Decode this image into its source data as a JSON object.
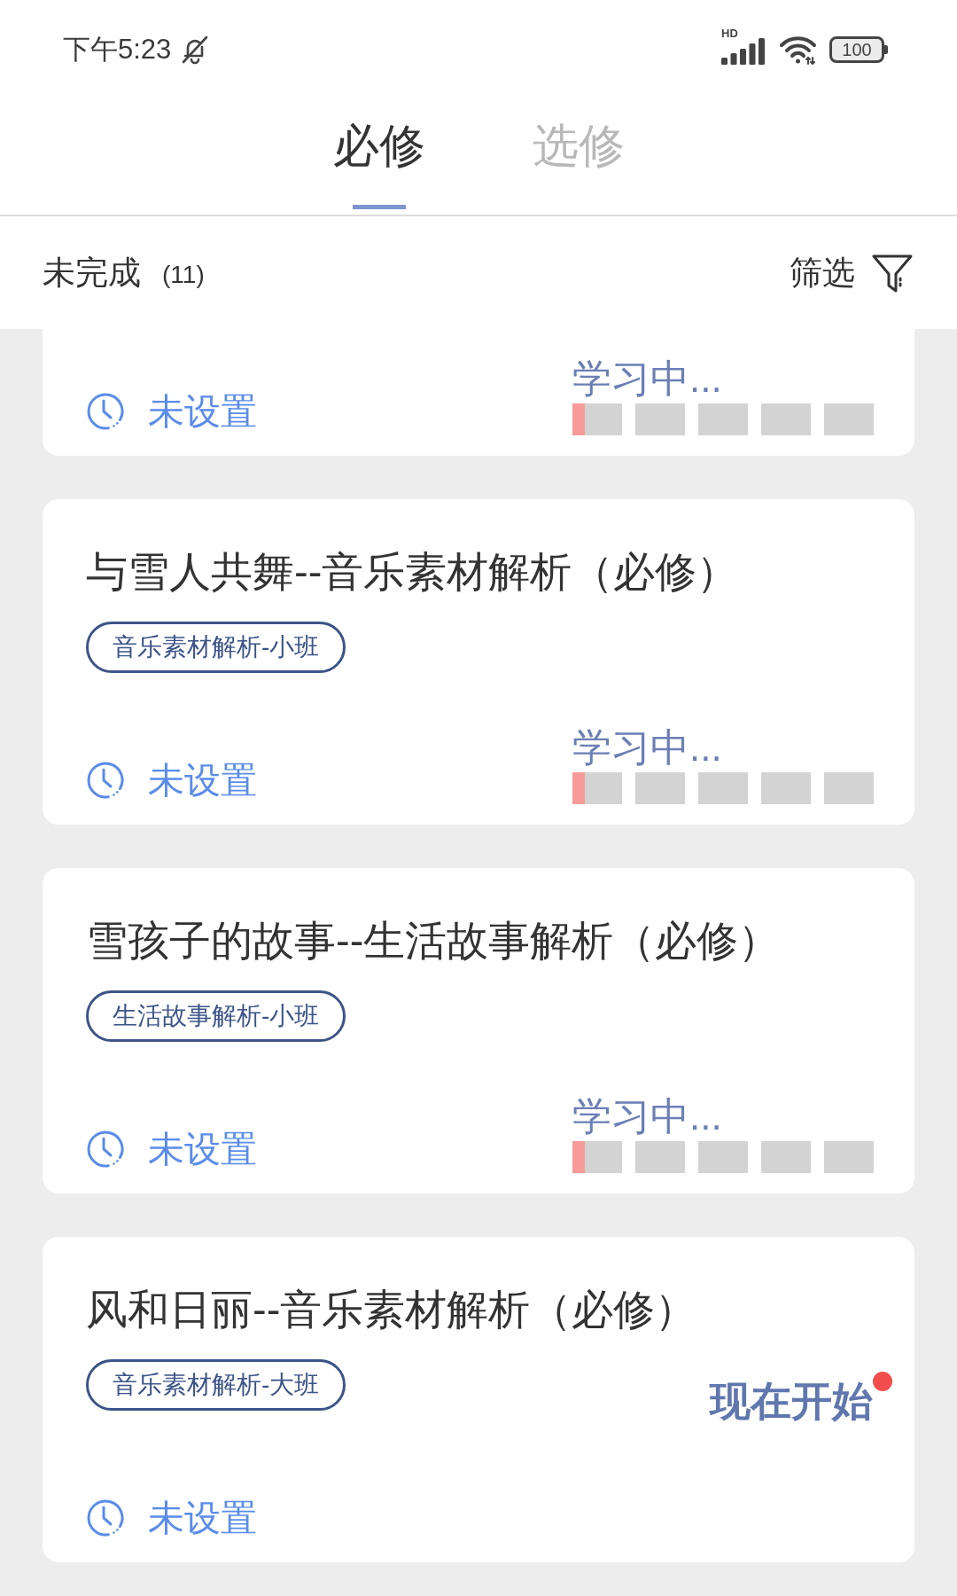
{
  "status_bar": {
    "time": "下午5:23",
    "network_label": "HD",
    "battery": "100"
  },
  "tabs": [
    {
      "label": "必修",
      "selected": true
    },
    {
      "label": "选修",
      "selected": false
    }
  ],
  "filter_bar": {
    "label": "未完成",
    "count": "(11)",
    "filter_label": "筛选"
  },
  "courses": [
    {
      "schedule": "未设置",
      "status": {
        "kind": "progress",
        "label": "学习中...",
        "level": 0.04
      }
    },
    {
      "title": "与雪人共舞--音乐素材解析（必修）",
      "tag": "音乐素材解析-小班",
      "schedule": "未设置",
      "status": {
        "kind": "progress",
        "label": "学习中...",
        "level": 0.04
      }
    },
    {
      "title": "雪孩子的故事--生活故事解析（必修）",
      "tag": "生活故事解析-小班",
      "schedule": "未设置",
      "status": {
        "kind": "progress",
        "label": "学习中...",
        "level": 0.04
      }
    },
    {
      "title": "风和日丽--音乐素材解析（必修）",
      "tag": "音乐素材解析-大班",
      "schedule": "未设置",
      "status": {
        "kind": "start",
        "label": "现在开始",
        "badge": true
      }
    }
  ]
}
